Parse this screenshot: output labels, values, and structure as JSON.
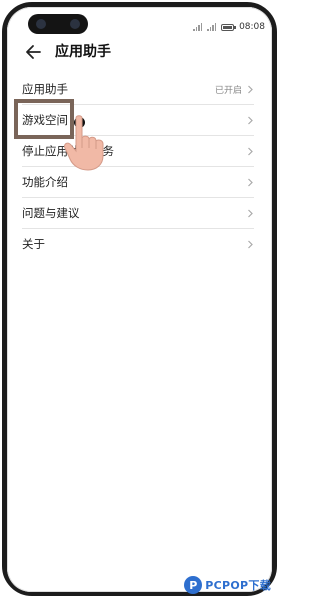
{
  "status": {
    "time": "08:08"
  },
  "header": {
    "title": "应用助手"
  },
  "items": [
    {
      "label": "应用助手",
      "value": "已开启"
    },
    {
      "label": "游戏空间"
    },
    {
      "label": "停止应用助手服务"
    },
    {
      "label": "功能介绍"
    },
    {
      "label": "问题与建议"
    },
    {
      "label": "关于"
    }
  ],
  "watermark": {
    "text": "PCPOP下载"
  },
  "icons": {
    "back": "back-arrow-icon",
    "chevron": "chevron-right-icon",
    "pointer": "hand-pointer-icon"
  },
  "colors": {
    "highlight_border": "#7a6559",
    "hand": "#f1b9a6",
    "watermark": "#2e6fcf"
  }
}
